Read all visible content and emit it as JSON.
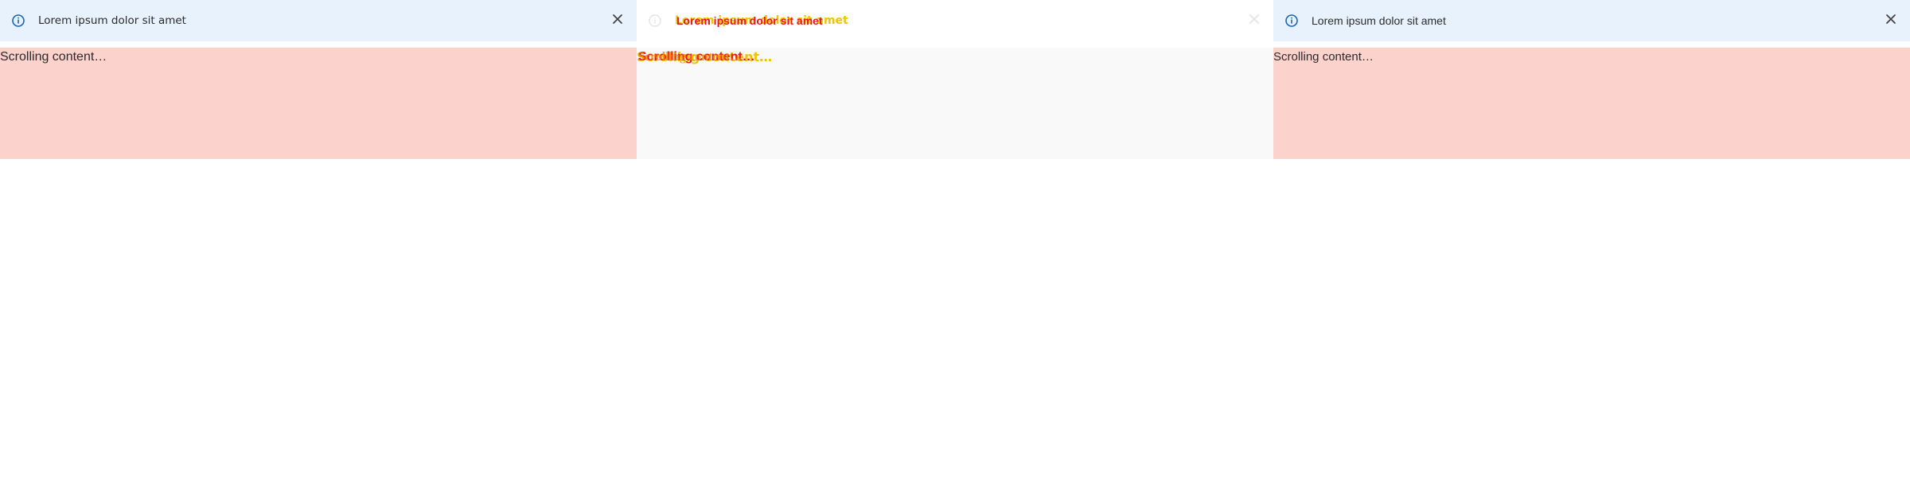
{
  "colors": {
    "banner_bg": "#e8f2fc",
    "content_bg": "#fcd2cd",
    "info_icon": "#1a66b3",
    "close_icon": "#444444",
    "diff_yellow": "#f0c400",
    "diff_red": "#e41a1a"
  },
  "icons": {
    "info": "info-circle-icon",
    "close": "close-x-icon"
  },
  "panels": [
    {
      "banner": {
        "message": "Lorem ipsum dolor sit amet"
      },
      "content": {
        "text": "Scrolling content…"
      }
    },
    {
      "banner": {
        "message": "Lorem ipsum dolor sit amet"
      },
      "content": {
        "text": "Scrolling content…"
      }
    },
    {
      "banner": {
        "message": "Lorem ipsum dolor sit amet"
      },
      "content": {
        "text": "Scrolling content…"
      }
    }
  ]
}
